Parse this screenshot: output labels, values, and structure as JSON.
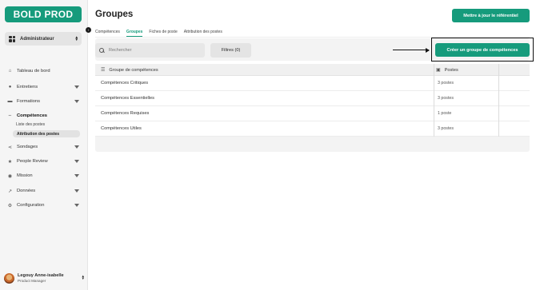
{
  "brand": {
    "logo_text": "BOLD PROD",
    "accent": "#169b7c"
  },
  "sidebar": {
    "role": "Administrateur",
    "items": [
      {
        "label": "Tableau de bord",
        "icon": "home-icon",
        "has_caret": false
      },
      {
        "label": "Entretiens",
        "icon": "chat-icon",
        "has_caret": true
      },
      {
        "label": "Formations",
        "icon": "briefcase-icon",
        "has_caret": true
      },
      {
        "label": "Compétences",
        "icon": "link-icon",
        "has_caret": false,
        "active": true
      },
      {
        "label": "Sondages",
        "icon": "share-icon",
        "has_caret": true
      },
      {
        "label": "People Review",
        "icon": "star-icon",
        "has_caret": true
      },
      {
        "label": "Mission",
        "icon": "globe-icon",
        "has_caret": true
      },
      {
        "label": "Données",
        "icon": "chart-icon",
        "has_caret": true
      },
      {
        "label": "Configuration",
        "icon": "gear-icon",
        "has_caret": true
      }
    ],
    "subitems": [
      {
        "label": "Liste des postes"
      },
      {
        "label": "Attribution des postes",
        "active": true
      }
    ],
    "user": {
      "name": "Legouy Anne-isabelle",
      "title": "Product Manager"
    }
  },
  "header": {
    "title": "Groupes",
    "update_button": "Mettre à jour le référentiel"
  },
  "tabs": [
    {
      "label": "Compétences"
    },
    {
      "label": "Groupes",
      "active": true
    },
    {
      "label": "Fiches de poste"
    },
    {
      "label": "Attribution des postes"
    }
  ],
  "toolbar": {
    "search_placeholder": "Rechercher",
    "filters_label": "Filtres (0)",
    "create_button": "Créer un groupe de compétences"
  },
  "table": {
    "columns": [
      {
        "label": "Groupe de compétences",
        "icon": "list-icon"
      },
      {
        "label": "Postes",
        "icon": "briefcase-icon"
      }
    ],
    "rows": [
      {
        "group": "Compétences Critiques",
        "postes": "3 postes"
      },
      {
        "group": "Compétences Essentielles",
        "postes": "3 postes"
      },
      {
        "group": "Compétences Requises",
        "postes": "1 poste"
      },
      {
        "group": "Compétences Utiles",
        "postes": "3 postes"
      }
    ]
  }
}
